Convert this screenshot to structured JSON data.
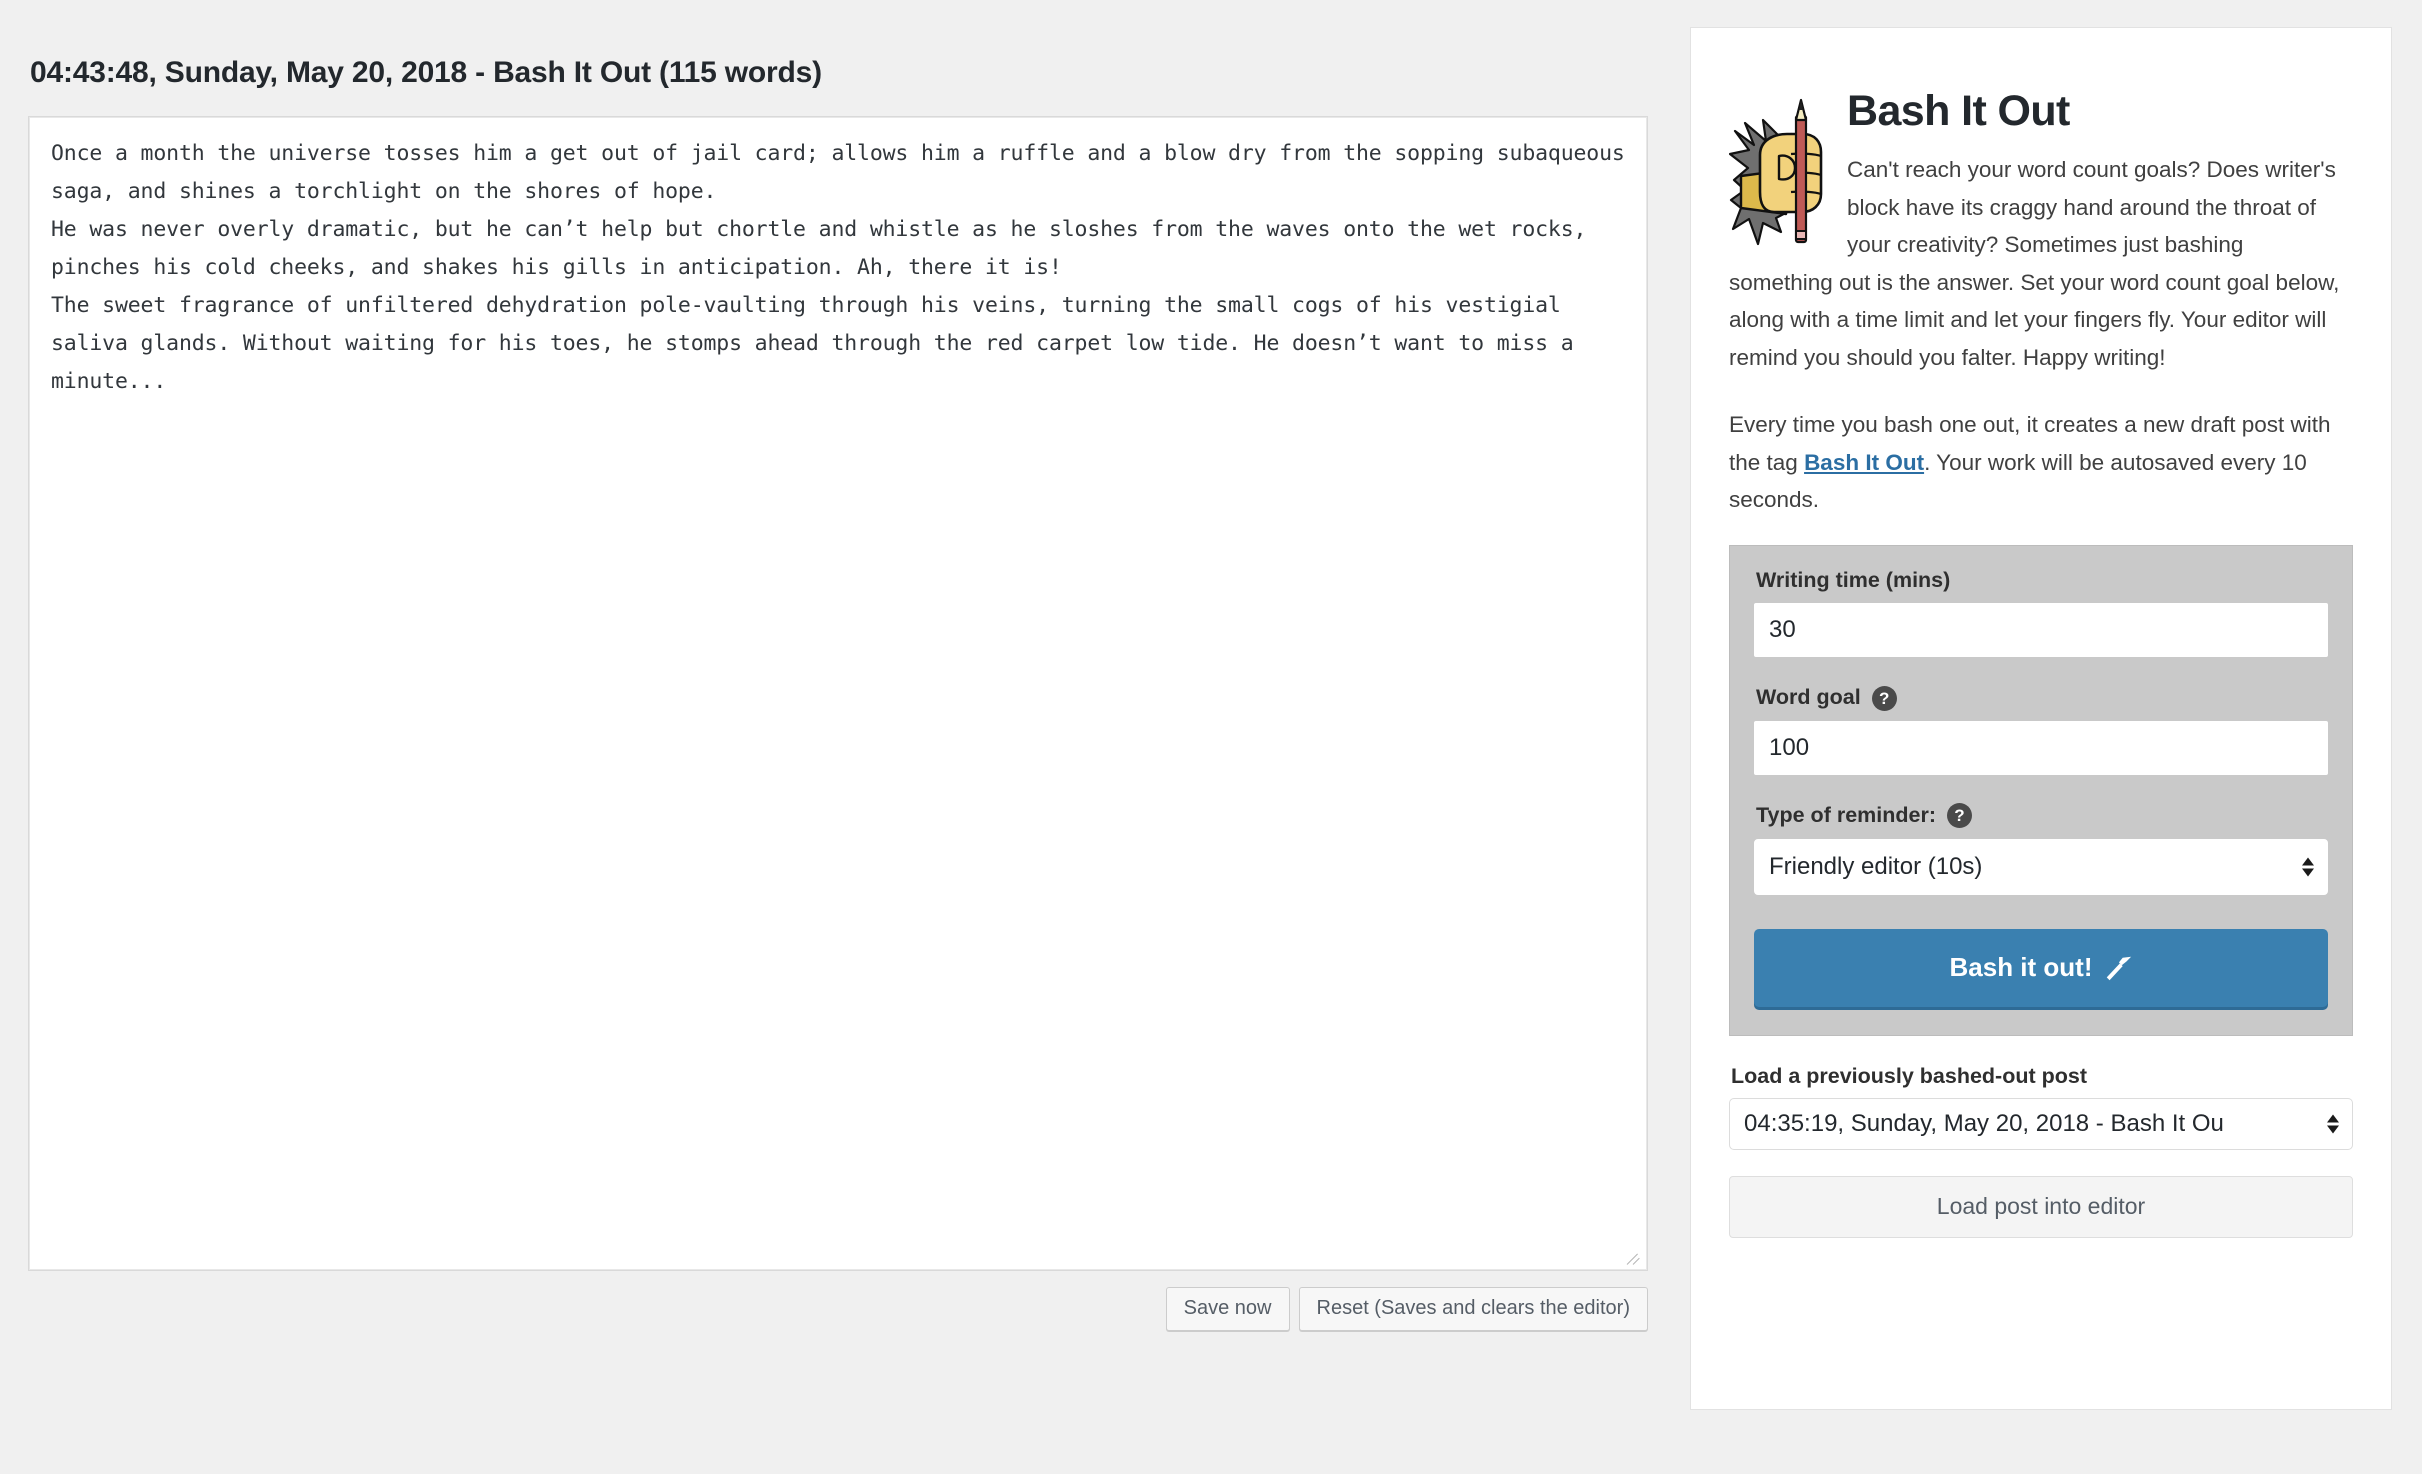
{
  "page": {
    "title": "04:43:48, Sunday, May 20, 2018 - Bash It Out (115 words)"
  },
  "editor": {
    "content": "Once a month the universe tosses him a get out of jail card; allows him a ruffle and a blow dry from the sopping subaqueous saga, and shines a torchlight on the shores of hope.\nHe was never overly dramatic, but he can’t help but chortle and whistle as he sloshes from the waves onto the wet rocks, pinches his cold cheeks, and shakes his gills in anticipation. Ah, there it is!\nThe sweet fragrance of unfiltered dehydration pole-vaulting through his veins, turning the small cogs of his vestigial saliva glands. Without waiting for his toes, he stomps ahead through the red carpet low tide. He doesn’t want to miss a minute...",
    "save_label": "Save now",
    "reset_label": "Reset (Saves and clears the editor)"
  },
  "sidebar": {
    "brand_title": "Bash It Out",
    "logo_icon": "fist-holding-pencil-icon",
    "description_1": "Can't reach your word count goals? Does writer's block have its craggy hand around the throat of your creativity? Sometimes just bashing something out is the answer. Set your word count goal below, along with a time limit and let your fingers fly. Your editor will remind you should you falter. Happy writing!",
    "description_2_before": "Every time you bash one out, it creates a new draft post with the tag ",
    "description_2_link": "Bash It Out",
    "description_2_after": ". Your work will be autosaved every 10 seconds.",
    "settings": {
      "writing_time_label": "Writing time (mins)",
      "writing_time_value": "30",
      "word_goal_label": "Word goal",
      "word_goal_help_icon": "question-mark-icon",
      "word_goal_value": "100",
      "reminder_label": "Type of reminder:",
      "reminder_help_icon": "question-mark-icon",
      "reminder_value": "Friendly editor (10s)",
      "bash_button_label": "Bash it out!",
      "bash_button_icon": "hammer-icon",
      "accent_color": "#3a80b0",
      "panel_color": "#c9c9c9"
    },
    "load": {
      "label": "Load a previously bashed-out post",
      "selected_post": "04:35:19, Sunday, May 20, 2018 - Bash It Ou",
      "button_label": "Load post into editor"
    }
  }
}
